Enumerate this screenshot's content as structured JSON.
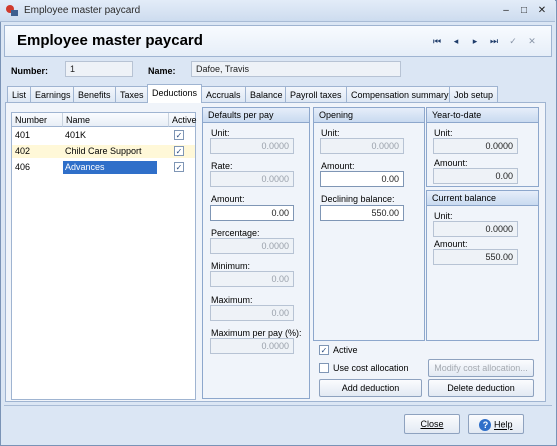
{
  "window": {
    "title": "Employee master paycard"
  },
  "header": {
    "title": "Employee master paycard",
    "nav": [
      {
        "icon": "first-record-icon",
        "glyph": "⏮"
      },
      {
        "icon": "previous-record-icon",
        "glyph": "◂"
      },
      {
        "icon": "next-record-icon",
        "glyph": "▸"
      },
      {
        "icon": "last-record-icon",
        "glyph": "⏭"
      },
      {
        "icon": "check-icon",
        "glyph": "✓"
      },
      {
        "icon": "cancel-icon",
        "glyph": "✕"
      }
    ]
  },
  "employee": {
    "number_label": "Number:",
    "number": "1",
    "name_label": "Name:",
    "name": "Dafoe, Travis"
  },
  "tabs": [
    {
      "label": "List"
    },
    {
      "label": "Earnings"
    },
    {
      "label": "Benefits"
    },
    {
      "label": "Taxes"
    },
    {
      "label": "Deductions"
    },
    {
      "label": "Accruals"
    },
    {
      "label": "Balance"
    },
    {
      "label": "Payroll taxes"
    },
    {
      "label": "Compensation summary"
    },
    {
      "label": "Job setup"
    }
  ],
  "deductions_table": {
    "columns": [
      "Number",
      "Name",
      "Active"
    ],
    "rows": [
      {
        "number": "401",
        "name": "401K",
        "active": "✓"
      },
      {
        "number": "402",
        "name": "Child Care Support",
        "active": "✓"
      },
      {
        "number": "406",
        "name": "Advances",
        "active": "✓"
      }
    ]
  },
  "defaults": {
    "title": "Defaults per pay",
    "unit_label": "Unit:",
    "unit": "0.0000",
    "rate_label": "Rate:",
    "rate": "0.0000",
    "amount_label": "Amount:",
    "amount": "0.00",
    "percentage_label": "Percentage:",
    "percentage": "0.0000",
    "minimum_label": "Minimum:",
    "minimum": "0.00",
    "maximum_label": "Maximum:",
    "maximum": "0.00",
    "max_per_pay_label": "Maximum per pay (%):",
    "max_per_pay": "0.0000"
  },
  "opening": {
    "title": "Opening",
    "unit_label": "Unit:",
    "unit": "0.0000",
    "amount_label": "Amount:",
    "amount": "0.00",
    "declining_label": "Declining balance:",
    "declining": "550.00"
  },
  "ytd": {
    "title": "Year-to-date",
    "unit_label": "Unit:",
    "unit": "0.0000",
    "amount_label": "Amount:",
    "amount": "0.00"
  },
  "current": {
    "title": "Current balance",
    "unit_label": "Unit:",
    "unit": "0.0000",
    "amount_label": "Amount:",
    "amount": "550.00"
  },
  "options": {
    "active_label": "Active",
    "active_check": "✓",
    "cost_alloc_label": "Use cost allocation",
    "modify_cost_label": "Modify cost allocation...",
    "add_label": "Add deduction",
    "delete_label": "Delete deduction"
  },
  "footer": {
    "close_label": "Close",
    "help_label": "Help"
  }
}
